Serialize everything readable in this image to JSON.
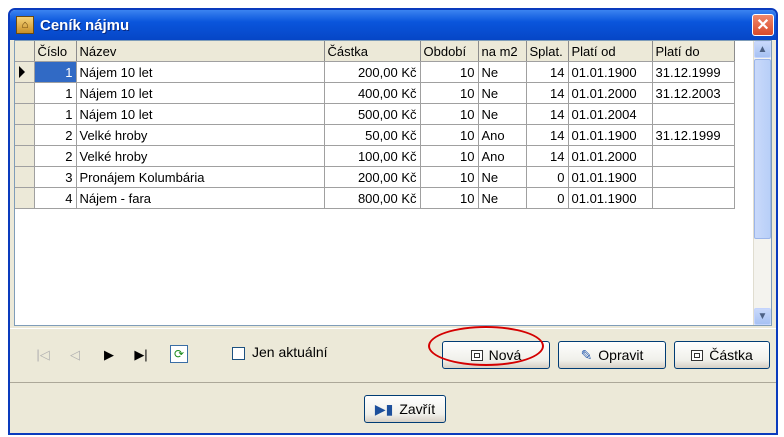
{
  "window": {
    "title": "Ceník nájmu",
    "close_glyph": "✕"
  },
  "grid": {
    "columns": [
      "Číslo",
      "Název",
      "Částka",
      "Období",
      "na m2",
      "Splat.",
      "Platí od",
      "Platí do"
    ],
    "rows": [
      [
        "1",
        "Nájem 10 let",
        "200,00 Kč",
        "10",
        "Ne",
        "14",
        "01.01.1900",
        "31.12.1999"
      ],
      [
        "1",
        "Nájem 10 let",
        "400,00 Kč",
        "10",
        "Ne",
        "14",
        "01.01.2000",
        "31.12.2003"
      ],
      [
        "1",
        "Nájem 10 let",
        "500,00 Kč",
        "10",
        "Ne",
        "14",
        "01.01.2004",
        ""
      ],
      [
        "2",
        "Velké hroby",
        "50,00 Kč",
        "10",
        "Ano",
        "14",
        "01.01.1900",
        "31.12.1999"
      ],
      [
        "2",
        "Velké hroby",
        "100,00 Kč",
        "10",
        "Ano",
        "14",
        "01.01.2000",
        ""
      ],
      [
        "3",
        "Pronájem Kolumbária",
        "200,00 Kč",
        "10",
        "Ne",
        "0",
        "01.01.1900",
        ""
      ],
      [
        "4",
        "Nájem - fara",
        "800,00 Kč",
        "10",
        "Ne",
        "0",
        "01.01.1900",
        ""
      ]
    ],
    "selected_row": 0
  },
  "toolbar": {
    "nav": [
      "first-icon",
      "prev-icon",
      "next-icon",
      "last-icon",
      "refresh-icon"
    ],
    "only_current_label": "Jen aktuální",
    "only_current_checked": false,
    "new_label": "Nová",
    "edit_label": "Opravit",
    "amount_label": "Částka"
  },
  "footer": {
    "close_label": "Zavřít"
  },
  "colors": {
    "titlebar": "#0a55dc",
    "selection": "#316ac5",
    "highlight_ellipse": "#d40000"
  }
}
